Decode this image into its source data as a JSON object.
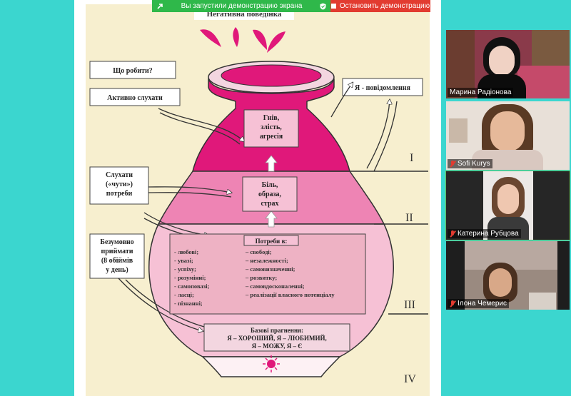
{
  "share_banner": {
    "message": "Вы запустили демонстрацию экрана",
    "stop_label": "Остановить демонстрацию",
    "bar_color": "#2fb84a",
    "stop_color": "#e23b30"
  },
  "slide": {
    "title": "Негативна поведінка",
    "jug_color_top": "#e0187a",
    "jug_color_mid": "#ee84b4",
    "jug_color_low": "#f6c1d5",
    "boxes": {
      "what_to_do": "Що робити?",
      "active_listen": "Активно слухати",
      "i_message": "Я - повідомлення",
      "listen_needs": [
        "Слухати",
        "(«чути»)",
        "потреби"
      ],
      "accept": [
        "Безумовно",
        "приймати",
        "(8 обіймів",
        "у день)"
      ],
      "anger": [
        "Гнів,",
        "злість,",
        "агресія"
      ],
      "pain": [
        "Біль,",
        "образа,",
        "страх"
      ],
      "needs_title": "Потреби в:",
      "needs_left": [
        "- любові;",
        "- увазі;",
        "- успіху;",
        "- розумінні;",
        "- самоповазі;",
        "- ласці;",
        "- пізнанні;"
      ],
      "needs_right": [
        "– свободі;",
        "– незалежності;",
        "– самовизначенні;",
        "– розвитку;",
        "– самовдосконаленні;",
        "– реалізації власного потенціалу"
      ],
      "base_title": "Базові прагнення:",
      "base_lines": [
        "Я – ХОРОШИЙ, Я – ЛЮБИМИЙ,",
        "Я – МОЖУ, Я – Є"
      ]
    },
    "levels": [
      "I",
      "II",
      "III",
      "IV"
    ]
  },
  "participants": [
    {
      "name": "Марина Радіонова",
      "muted": false,
      "active": false
    },
    {
      "name": "Sofi Kurys",
      "muted": true,
      "active": false
    },
    {
      "name": "Катерина Рубцова",
      "muted": true,
      "active": true
    },
    {
      "name": "Ілона Чемерис",
      "muted": true,
      "active": false
    }
  ]
}
